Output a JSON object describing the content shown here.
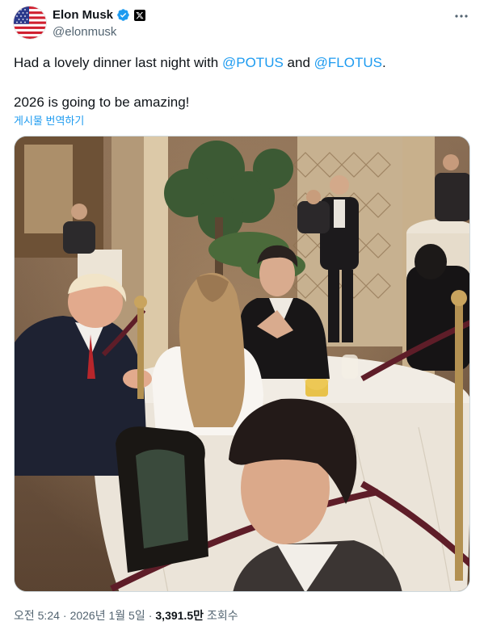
{
  "author": {
    "display_name": "Elon Musk",
    "handle": "@elonmusk",
    "avatar_icon": "us-flag-icon",
    "verified_icon": "verified-badge-icon",
    "affiliation_icon": "x-logo-icon",
    "verified_color": "#1d9bf0"
  },
  "menu": {
    "icon": "more-horizontal-icon"
  },
  "post": {
    "line1_prefix": "Had a lovely dinner last night with ",
    "mention1": "@POTUS",
    "line1_and": " and ",
    "mention2": "@FLOTUS",
    "line1_suffix": ".",
    "line2": "2026 is going to be amazing!",
    "mention_color": "#1d9bf0"
  },
  "translate_label": "게시물 번역하기",
  "meta": {
    "time": "오전 5:24",
    "separator": "·",
    "date": "2026년 1월 5일",
    "views_count": "3,391.5만",
    "views_label": "조회수"
  }
}
